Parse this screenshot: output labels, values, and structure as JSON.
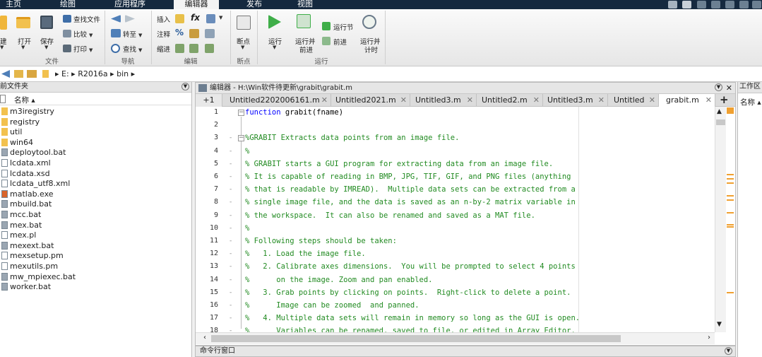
{
  "main_tabs": [
    "主页",
    "绘图",
    "应用程序",
    "编辑器",
    "发布",
    "视图"
  ],
  "ribbon": {
    "file": {
      "new": "建",
      "open": "打开",
      "save": "保存",
      "find_files": "查找文件",
      "compare": "比较",
      "print": "打印",
      "group": "文件"
    },
    "nav": {
      "goto": "转至",
      "find": "查找",
      "group": "导航"
    },
    "edit": {
      "insert": "插入",
      "comment": "注释",
      "indent": "缩进",
      "fx": "fx",
      "group": "编辑"
    },
    "breakpoints": {
      "label": "断点",
      "group": "断点"
    },
    "run": {
      "run": "运行",
      "run_advance_1": "运行并",
      "run_advance_2": "前进",
      "run_section": "运行节",
      "advance": "前进",
      "run_time_1": "运行并",
      "run_time_2": "计时",
      "group": "运行"
    }
  },
  "address": {
    "path": [
      "E:",
      "R2016a",
      "bin"
    ]
  },
  "left_panel": {
    "title": "前文件夹",
    "col": "名称 ▴",
    "files": [
      {
        "name": "m3iregistry",
        "type": "folder"
      },
      {
        "name": "registry",
        "type": "folder"
      },
      {
        "name": "util",
        "type": "folder"
      },
      {
        "name": "win64",
        "type": "folder"
      },
      {
        "name": "deploytool.bat",
        "type": "bat"
      },
      {
        "name": "lcdata.xml",
        "type": "file"
      },
      {
        "name": "lcdata.xsd",
        "type": "file"
      },
      {
        "name": "lcdata_utf8.xml",
        "type": "file"
      },
      {
        "name": "matlab.exe",
        "type": "exe"
      },
      {
        "name": "mbuild.bat",
        "type": "bat"
      },
      {
        "name": "mcc.bat",
        "type": "bat"
      },
      {
        "name": "mex.bat",
        "type": "bat"
      },
      {
        "name": "mex.pl",
        "type": "file"
      },
      {
        "name": "mexext.bat",
        "type": "bat"
      },
      {
        "name": "mexsetup.pm",
        "type": "file"
      },
      {
        "name": "mexutils.pm",
        "type": "file"
      },
      {
        "name": "mw_mpiexec.bat",
        "type": "bat"
      },
      {
        "name": "worker.bat",
        "type": "bat"
      }
    ]
  },
  "editor": {
    "title": "编辑器 - H:\\Win软件待更新\\grabit\\grabit.m",
    "tabs": [
      "+1",
      "Untitled2202006161.m",
      "Untitled2021.m",
      "Untitled3.m",
      "Untitled2.m",
      "Untitled3.m",
      "Untitled",
      "grabit.m"
    ],
    "lines": [
      "function grabit(fname)",
      "",
      "%GRABIT Extracts data points from an image file.",
      "%",
      "% GRABIT starts a GUI program for extracting data from an image file.",
      "% It is capable of reading in BMP, JPG, TIF, GIF, and PNG files (anything",
      "% that is readable by IMREAD).  Multiple data sets can be extracted from a",
      "% single image file, and the data is saved as an n-by-2 matrix variable in",
      "% the workspace.  It can also be renamed and saved as a MAT file.",
      "%",
      "% Following steps should be taken:",
      "%   1. Load the image file.",
      "%   2. Calibrate axes dimensions.  You will be prompted to select 4 points",
      "%      on the image. Zoom and pan enabled.",
      "%   3. Grab points by clicking on points.  Right-click to delete a point.",
      "%      Image can be zoomed  and panned.",
      "%   4. Multiple data sets will remain in memory so long as the GUI is open.",
      "%      Variables can be renamed, saved to file, or edited in Array Editor."
    ],
    "line_numbers": [
      "1",
      "2",
      "3",
      "4",
      "5",
      "6",
      "7",
      "8",
      "9",
      "10",
      "11",
      "12",
      "13",
      "14",
      "15",
      "16",
      "17",
      "18"
    ]
  },
  "right_panel": {
    "title": "工作区",
    "col": "名称 ▴"
  },
  "command_window": {
    "title": "命令行窗口"
  }
}
